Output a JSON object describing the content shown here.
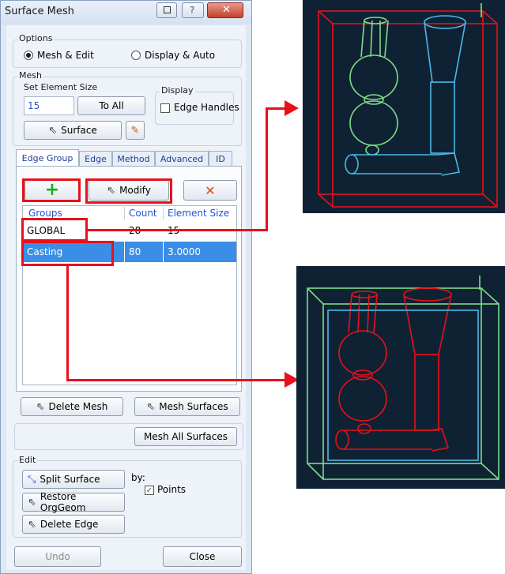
{
  "window": {
    "title": "Surface Mesh"
  },
  "options": {
    "label": "Options",
    "mesh_edit": "Mesh & Edit",
    "display_auto": "Display & Auto"
  },
  "mesh": {
    "label": "Mesh",
    "set_element_size": "Set Element Size",
    "size_value": "15",
    "to_all": "To All",
    "surface": "Surface",
    "display_label": "Display",
    "edge_handles": "Edge Handles"
  },
  "tabs": [
    "Edge Group",
    "Edge",
    "Method",
    "Advanced",
    "ID"
  ],
  "edge_group": {
    "add": "+",
    "modify": "Modify",
    "delete": "✕",
    "columns": [
      "Groups",
      "Count",
      "Element Size"
    ],
    "rows": [
      {
        "group": "GLOBAL",
        "count": "28",
        "size": "15"
      },
      {
        "group": "Casting",
        "count": "80",
        "size": "3.0000"
      }
    ]
  },
  "actions": {
    "delete_mesh": "Delete Mesh",
    "mesh_surfaces": "Mesh Surfaces",
    "mesh_all_surfaces": "Mesh All Surfaces"
  },
  "edit": {
    "label": "Edit",
    "split_surface": "Split Surface",
    "restore_orggeom": "Restore OrgGeom",
    "delete_edge": "Delete Edge",
    "by": "by:",
    "points": "Points"
  },
  "footer": {
    "undo": "Undo",
    "close": "Close"
  },
  "colors": {
    "highlight": "#e8101a",
    "selection": "#3a8ee6",
    "panel_bg": "#0f2233"
  }
}
